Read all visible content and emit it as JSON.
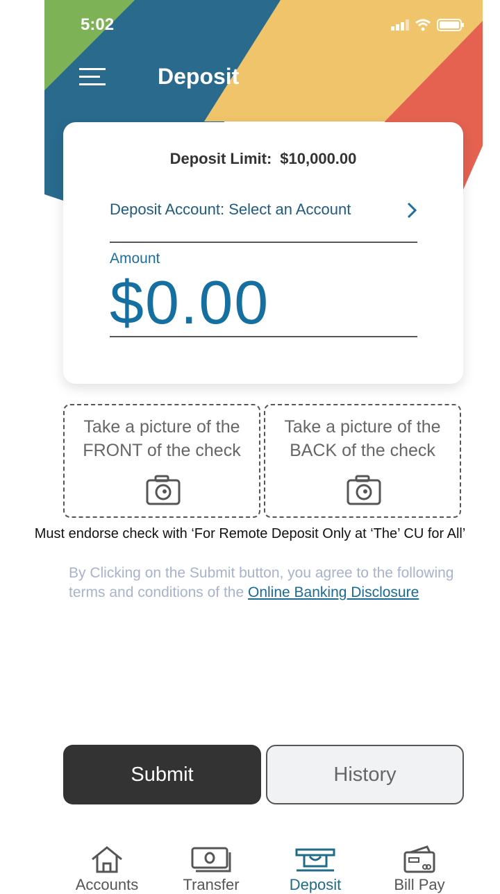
{
  "status_bar": {
    "time": "5:02"
  },
  "header": {
    "title": "Deposit"
  },
  "card": {
    "limit_label": "Deposit Limit:",
    "limit_value": "$10,000.00",
    "account_label": "Deposit Account: Select an Account",
    "amount_label": "Amount",
    "amount_value": "$0.00"
  },
  "photos": {
    "front_line1": "Take a picture of the",
    "front_line2": "FRONT of the check",
    "back_line1": "Take a picture of the",
    "back_line2": "BACK of the check"
  },
  "endorse_note": "Must endorse check with ‘For Remote Deposit Only at ‘The’ CU for All’",
  "terms": {
    "text": "By Clicking on the Submit button, you agree to the following terms and conditions of the",
    "link": "Online Banking Disclosure"
  },
  "buttons": {
    "submit": "Submit",
    "history": "History"
  },
  "tabs": [
    {
      "label": "Accounts",
      "icon": "home-icon"
    },
    {
      "label": "Transfer",
      "icon": "cash-icon"
    },
    {
      "label": "Deposit",
      "icon": "deposit-icon"
    },
    {
      "label": "Bill Pay",
      "icon": "card-icon"
    }
  ],
  "colors": {
    "banner_green": "#7db356",
    "banner_blue": "#2a6a8d",
    "banner_yellow": "#efc46a",
    "banner_red": "#e56251",
    "accent": "#156fa0",
    "submit_bg": "#333333"
  }
}
